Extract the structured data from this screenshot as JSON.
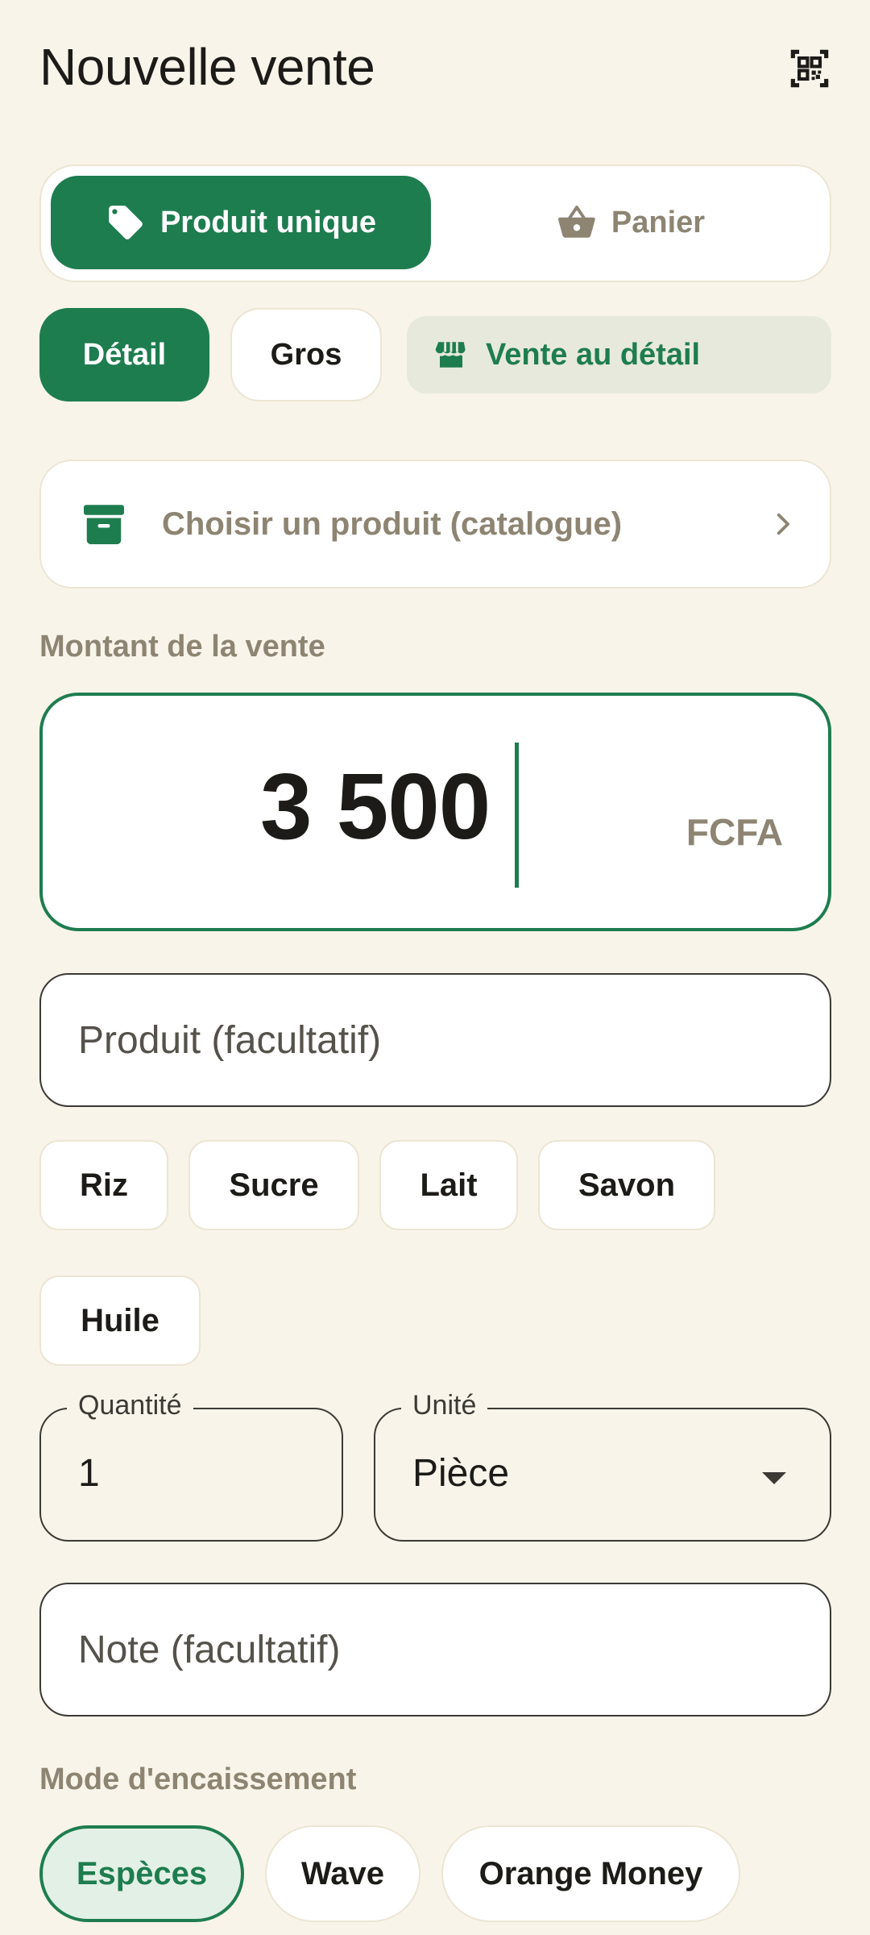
{
  "header": {
    "title": "Nouvelle vente",
    "scan_icon": "qr-code-icon"
  },
  "mode_toggle": {
    "options": [
      {
        "label": "Produit unique",
        "icon": "tag-icon",
        "selected": true
      },
      {
        "label": "Panier",
        "icon": "basket-icon",
        "selected": false
      }
    ]
  },
  "pricing": {
    "options": [
      {
        "label": "Détail",
        "selected": true
      },
      {
        "label": "Gros",
        "selected": false
      }
    ],
    "badge": {
      "label": "Vente au détail",
      "icon": "store-icon"
    }
  },
  "catalog": {
    "label": "Choisir un produit (catalogue)",
    "icon": "archive-box-icon"
  },
  "amount": {
    "label": "Montant de la vente",
    "value": "3 500",
    "currency": "FCFA"
  },
  "product_field": {
    "placeholder": "Produit (facultatif)"
  },
  "suggestions": [
    "Riz",
    "Sucre",
    "Lait",
    "Savon",
    "Huile"
  ],
  "quantity": {
    "label": "Quantité",
    "value": "1"
  },
  "unit": {
    "label": "Unité",
    "value": "Pièce"
  },
  "note_field": {
    "placeholder": "Note (facultatif)"
  },
  "payment": {
    "label": "Mode d'encaissement",
    "options": [
      {
        "label": "Espèces",
        "selected": true
      },
      {
        "label": "Wave",
        "selected": false
      },
      {
        "label": "Orange Money",
        "selected": false
      }
    ]
  },
  "colors": {
    "primary": "#1e7d4f",
    "background": "#f8f4e9",
    "muted": "#8d8472"
  }
}
